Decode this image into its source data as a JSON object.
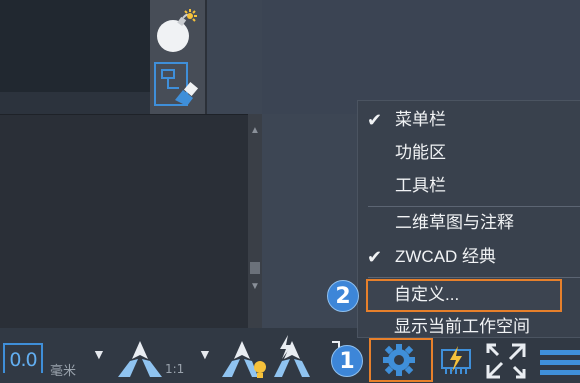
{
  "menu": {
    "items": [
      {
        "label": "菜单栏",
        "checked": true
      },
      {
        "label": "功能区",
        "checked": false
      },
      {
        "label": "工具栏",
        "checked": false
      },
      {
        "label": "二维草图与注释",
        "checked": false
      },
      {
        "label": "ZWCAD 经典",
        "checked": true
      },
      {
        "label": "自定义...",
        "checked": false,
        "highlighted": true
      },
      {
        "label": "显示当前工作空间",
        "checked": false
      }
    ],
    "check_glyph": "✔"
  },
  "status_bar": {
    "scale_value": "0.0",
    "unit": "毫米",
    "ratio": "1:1",
    "caret": "▼"
  },
  "scroll": {
    "up": "▲",
    "down": "▼"
  },
  "badges": {
    "step1": "1",
    "step2": "2"
  },
  "colors": {
    "accent_blue": "#3f8fd9",
    "highlight_orange": "#e7802b",
    "badge_blue": "#3d86d8",
    "menu_bg": "#39414d",
    "icon_yellow": "#f5c13b"
  },
  "icons": [
    "bomb-icon",
    "layout-brush-icon",
    "annotation-scale-icon",
    "annotation-visibility-icon",
    "auto-scale-icon",
    "workspace-gear-icon",
    "hardware-acceleration-icon",
    "fullscreen-icon",
    "customization-menu-icon"
  ]
}
